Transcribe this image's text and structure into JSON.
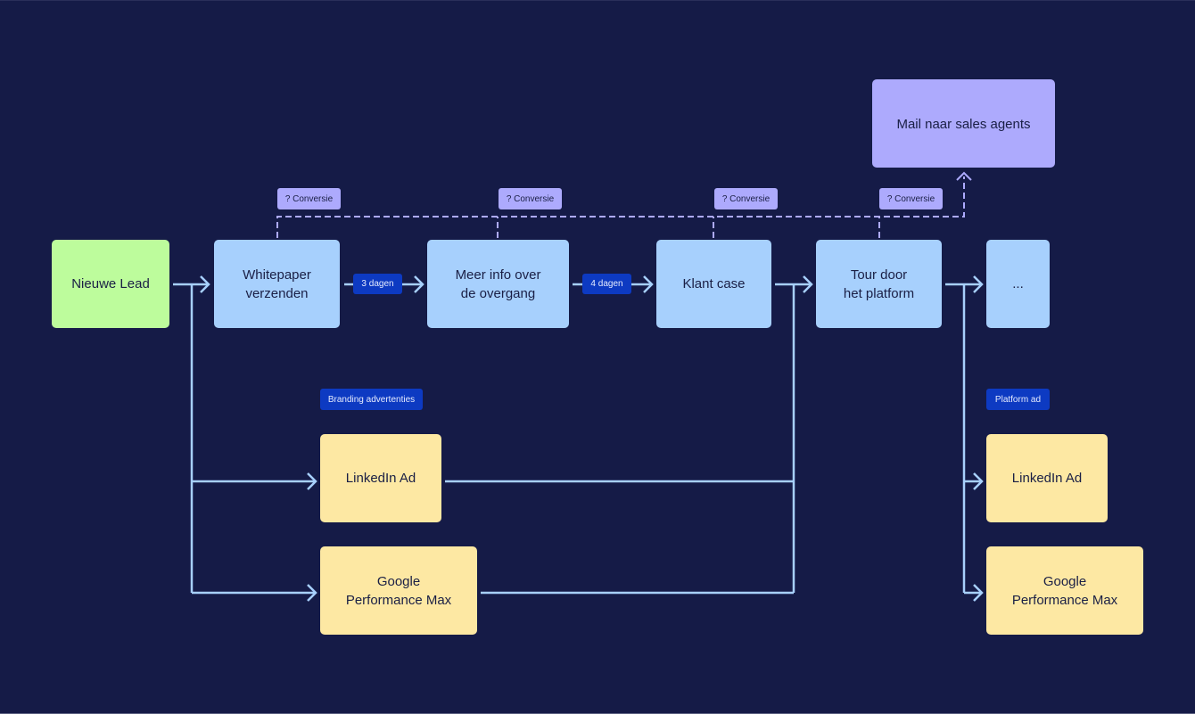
{
  "diagram": {
    "colors": {
      "background": "#151b47",
      "lead": "#bdfc9c",
      "step": "#a7d0fd",
      "sales": "#adaafd",
      "ad": "#fde8a3",
      "delay_tag": "#0d3ac2",
      "conversion_tag": "#adaafd",
      "connector": "#a7d0fd",
      "conversion_line": "#adaafd"
    },
    "nodes": {
      "lead": "Nieuwe Lead",
      "whitepaper": "Whitepaper\nverzenden",
      "meer_info": "Meer info over\nde overgang",
      "klant_case": "Klant case",
      "tour": "Tour door\nhet platform",
      "more": "...",
      "mail_sales": "Mail naar sales agents",
      "linkedin_ad_1": "LinkedIn Ad",
      "google_pmax_1": "Google\nPerformance Max",
      "linkedin_ad_2": "LinkedIn Ad",
      "google_pmax_2": "Google\nPerformance Max"
    },
    "tags": {
      "conversie_1": "? Conversie",
      "conversie_2": "? Conversie",
      "conversie_3": "? Conversie",
      "conversie_4": "? Conversie",
      "delay_1": "3 dagen",
      "delay_2": "4 dagen",
      "branding": "Branding advertenties",
      "platform": "Platform ad"
    },
    "edges": [
      {
        "from": "lead",
        "to": "whitepaper",
        "style": "solid"
      },
      {
        "from": "whitepaper",
        "to": "meer_info",
        "label": "3 dagen",
        "style": "solid"
      },
      {
        "from": "meer_info",
        "to": "klant_case",
        "label": "4 dagen",
        "style": "solid"
      },
      {
        "from": "klant_case",
        "to": "tour",
        "style": "solid"
      },
      {
        "from": "tour",
        "to": "more",
        "style": "solid"
      },
      {
        "from": "lead",
        "to": "linkedin_ad_1",
        "style": "solid"
      },
      {
        "from": "lead",
        "to": "google_pmax_1",
        "style": "solid"
      },
      {
        "from": "linkedin_ad_1",
        "to": "tour",
        "style": "solid"
      },
      {
        "from": "google_pmax_1",
        "to": "tour",
        "style": "solid"
      },
      {
        "from": "tour",
        "to": "linkedin_ad_2",
        "style": "solid"
      },
      {
        "from": "tour",
        "to": "google_pmax_2",
        "style": "solid"
      },
      {
        "from": "whitepaper",
        "to": "mail_sales",
        "label": "? Conversie",
        "style": "dashed"
      },
      {
        "from": "meer_info",
        "to": "mail_sales",
        "label": "? Conversie",
        "style": "dashed"
      },
      {
        "from": "klant_case",
        "to": "mail_sales",
        "label": "? Conversie",
        "style": "dashed"
      },
      {
        "from": "tour",
        "to": "mail_sales",
        "label": "? Conversie",
        "style": "dashed"
      }
    ]
  }
}
